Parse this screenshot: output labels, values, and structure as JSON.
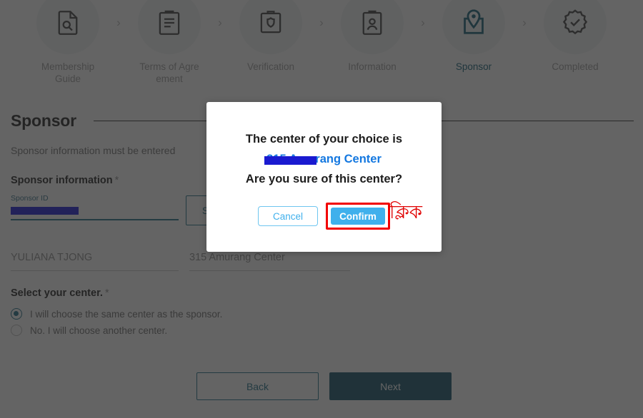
{
  "stepper": {
    "separator": "›",
    "steps": [
      {
        "label": "Membership Guide",
        "icon": "document-search-icon",
        "active": false
      },
      {
        "label": "Terms of Agre ement",
        "icon": "clipboard-lines-icon",
        "active": false
      },
      {
        "label": "Verification",
        "icon": "clipboard-shield-icon",
        "active": false
      },
      {
        "label": "Information",
        "icon": "clipboard-person-icon",
        "active": false
      },
      {
        "label": "Sponsor",
        "icon": "map-pin-icon",
        "active": true
      },
      {
        "label": "Completed",
        "icon": "badge-check-icon",
        "active": false
      }
    ]
  },
  "section": {
    "title": "Sponsor",
    "description": "Sponsor information must be entered",
    "group_title": "Sponsor information",
    "required_mark": "*"
  },
  "sponsor_id": {
    "label": "Sponsor ID",
    "value": "",
    "redacted": true
  },
  "search_button": {
    "label": "Search"
  },
  "results": {
    "sponsor_name": "YULIANA TJONG",
    "sponsor_center": "315 Amurang Center"
  },
  "center_choice": {
    "title": "Select your center.",
    "required_mark": "*",
    "options": [
      {
        "label": "I will choose the same center as the sponsor.",
        "selected": true
      },
      {
        "label": "No. I will choose another center.",
        "selected": false
      }
    ]
  },
  "footer": {
    "back_label": "Back",
    "next_label": "Next"
  },
  "modal": {
    "line1": "The center of your choice is",
    "center_name": "315 Amurang Center",
    "center_name_visible": "ang Center",
    "line3": "Are you sure of this center?",
    "cancel_label": "Cancel",
    "confirm_label": "Confirm"
  },
  "annotation": {
    "text": "ক্লিক"
  },
  "colors": {
    "accent_teal": "#1b6b86",
    "next_button": "#0b4d66",
    "modal_blue": "#3fb0ec",
    "link_blue": "#1478e0",
    "highlight_red": "#f20000",
    "redaction_blue": "#1a1ad0",
    "overlay": "rgba(40,40,40,0.72)"
  }
}
